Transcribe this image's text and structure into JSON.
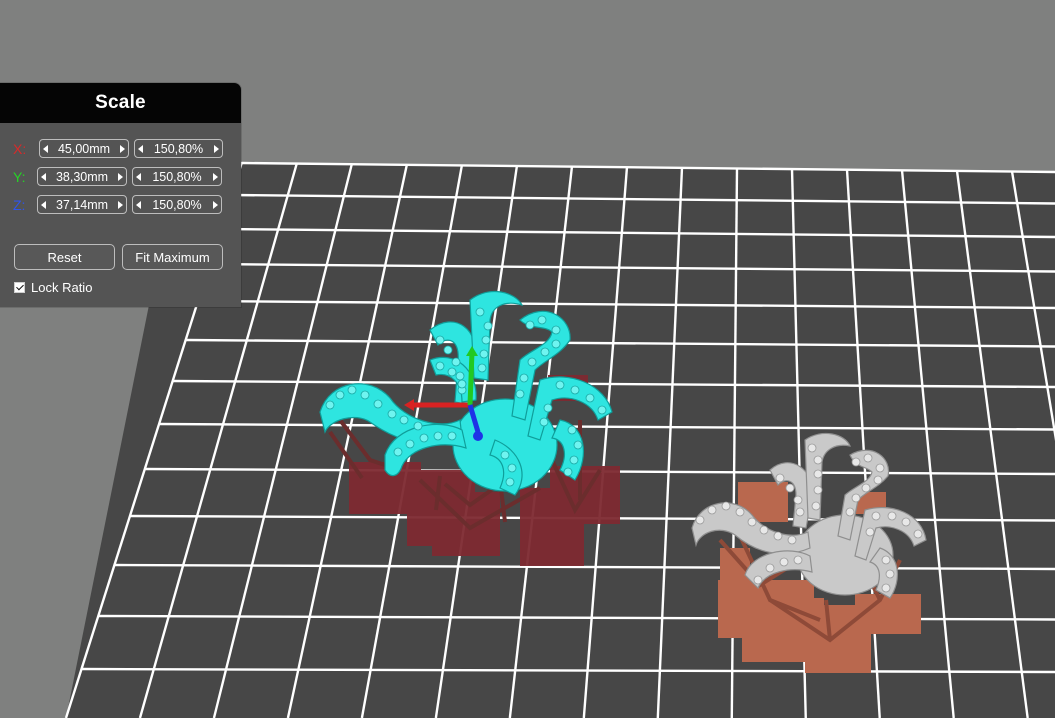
{
  "panel": {
    "title": "Scale",
    "rows": [
      {
        "axis": "X:",
        "color": "#d82a2a",
        "size": "45,00mm",
        "percent": "150,80%"
      },
      {
        "axis": "Y:",
        "color": "#26d326",
        "size": "38,30mm",
        "percent": "150,80%"
      },
      {
        "axis": "Z:",
        "color": "#2f55ea",
        "size": "37,14mm",
        "percent": "150,80%"
      }
    ],
    "reset_label": "Reset",
    "fit_label": "Fit Maximum",
    "lock_label": "Lock Ratio",
    "lock_checked": true
  },
  "scene": {
    "background_color": "#7f807f",
    "build_plate_color": "#474747",
    "grid_color": "#ffffff",
    "selected_model_color": "#2ee5e0",
    "unselected_model_color": "#c9c9c9",
    "selected_support_color": "#7a3636",
    "unselected_support_color": "#b06a4f",
    "selected_raft_color": "#7e2a31",
    "unselected_raft_color": "#b9684e"
  }
}
